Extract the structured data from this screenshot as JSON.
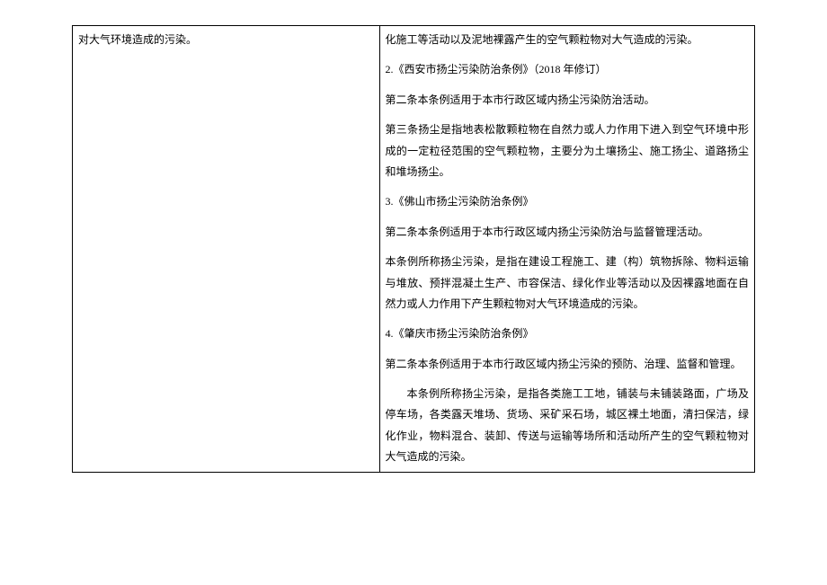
{
  "table": {
    "left": {
      "p1": "对大气环境造成的污染。"
    },
    "right": {
      "p1": "化施工等活动以及泥地裸露产生的空气颗粒物对大气造成的污染。",
      "p2": "2.《西安市扬尘污染防治条例》（2018 年修订）",
      "p3": "第二条本条例适用于本市行政区域内扬尘污染防治活动。",
      "p4": "第三条扬尘是指地表松散颗粒物在自然力或人力作用下进入到空气环境中形成的一定粒径范围的空气颗粒物，主要分为土壤扬尘、施工扬尘、道路扬尘和堆场扬尘。",
      "p5": "3.《佛山市扬尘污染防治条例》",
      "p6": "第二条本条例适用于本市行政区域内扬尘污染防治与监督管理活动。",
      "p7": "本条例所称扬尘污染，是指在建设工程施工、建（构）筑物拆除、物料运输与堆放、预拌混凝土生产、市容保洁、绿化作业等活动以及因裸露地面在自然力或人力作用下产生颗粒物对大气环境造成的污染。",
      "p8": "4.《肇庆市扬尘污染防治条例》",
      "p9": "第二条本条例适用于本市行政区域内扬尘污染的预防、治理、监督和管理。",
      "p10": "本条例所称扬尘污染，是指各类施工工地，铺装与未铺装路面，广场及停车场，各类露天堆场、货场、采矿采石场，城区裸土地面，清扫保洁，绿化作业，物料混合、装卸、传送与运输等场所和活动所产生的空气颗粒物对大气造成的污染。"
    }
  }
}
